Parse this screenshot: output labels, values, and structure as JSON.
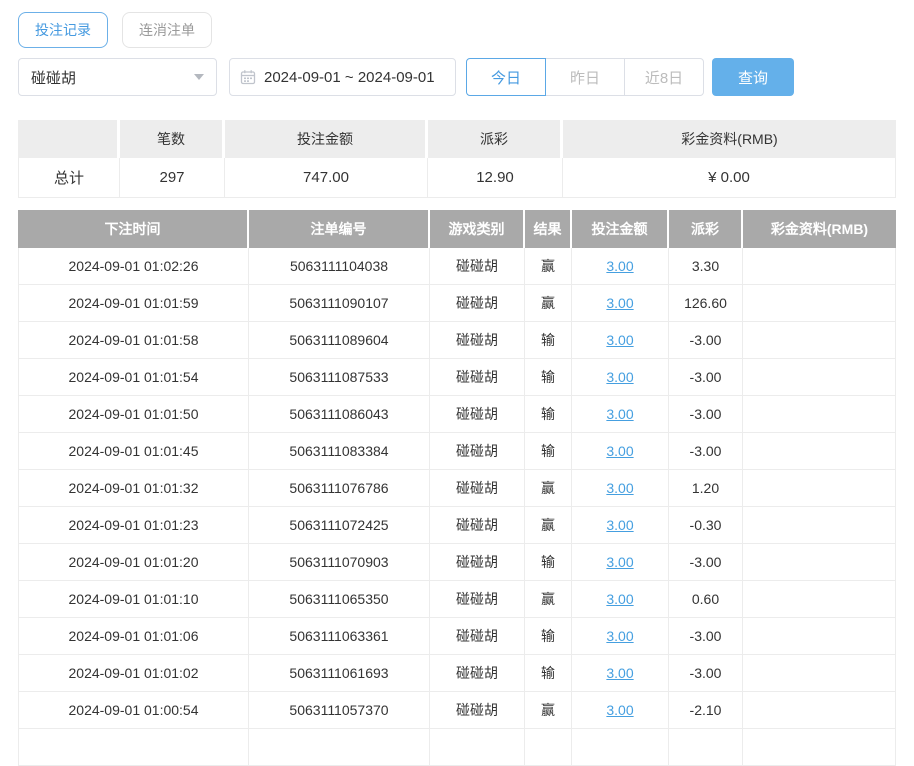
{
  "tabs": {
    "records_label": "投注记录",
    "cancelled_label": "连消注单"
  },
  "filters": {
    "game_select": {
      "value": "碰碰胡"
    },
    "date_range": {
      "value": "2024-09-01 ~ 2024-09-01"
    },
    "quick_buttons": [
      {
        "label": "今日",
        "active": true
      },
      {
        "label": "昨日",
        "active": false
      },
      {
        "label": "近8日",
        "active": false
      }
    ],
    "search_label": "查询"
  },
  "summary": {
    "headers": [
      "",
      "笔数",
      "投注金额",
      "派彩",
      "彩金资料(RMB)"
    ],
    "row": {
      "label": "总计",
      "count": "297",
      "bet_amount": "747.00",
      "payout": "12.90",
      "bonus": "¥ 0.00"
    }
  },
  "table": {
    "headers": [
      "下注时间",
      "注单编号",
      "游戏类别",
      "结果",
      "投注金额",
      "派彩",
      "彩金资料(RMB)"
    ],
    "rows": [
      {
        "time": "2024-09-01 01:02:26",
        "order_id": "5063111104038",
        "game": "碰碰胡",
        "result": "赢",
        "bet": "3.00",
        "payout": "3.30",
        "bonus": ""
      },
      {
        "time": "2024-09-01 01:01:59",
        "order_id": "5063111090107",
        "game": "碰碰胡",
        "result": "赢",
        "bet": "3.00",
        "payout": "126.60",
        "bonus": ""
      },
      {
        "time": "2024-09-01 01:01:58",
        "order_id": "5063111089604",
        "game": "碰碰胡",
        "result": "输",
        "bet": "3.00",
        "payout": "-3.00",
        "bonus": ""
      },
      {
        "time": "2024-09-01 01:01:54",
        "order_id": "5063111087533",
        "game": "碰碰胡",
        "result": "输",
        "bet": "3.00",
        "payout": "-3.00",
        "bonus": ""
      },
      {
        "time": "2024-09-01 01:01:50",
        "order_id": "5063111086043",
        "game": "碰碰胡",
        "result": "输",
        "bet": "3.00",
        "payout": "-3.00",
        "bonus": ""
      },
      {
        "time": "2024-09-01 01:01:45",
        "order_id": "5063111083384",
        "game": "碰碰胡",
        "result": "输",
        "bet": "3.00",
        "payout": "-3.00",
        "bonus": ""
      },
      {
        "time": "2024-09-01 01:01:32",
        "order_id": "5063111076786",
        "game": "碰碰胡",
        "result": "赢",
        "bet": "3.00",
        "payout": "1.20",
        "bonus": ""
      },
      {
        "time": "2024-09-01 01:01:23",
        "order_id": "5063111072425",
        "game": "碰碰胡",
        "result": "赢",
        "bet": "3.00",
        "payout": "-0.30",
        "bonus": ""
      },
      {
        "time": "2024-09-01 01:01:20",
        "order_id": "5063111070903",
        "game": "碰碰胡",
        "result": "输",
        "bet": "3.00",
        "payout": "-3.00",
        "bonus": ""
      },
      {
        "time": "2024-09-01 01:01:10",
        "order_id": "5063111065350",
        "game": "碰碰胡",
        "result": "赢",
        "bet": "3.00",
        "payout": "0.60",
        "bonus": ""
      },
      {
        "time": "2024-09-01 01:01:06",
        "order_id": "5063111063361",
        "game": "碰碰胡",
        "result": "输",
        "bet": "3.00",
        "payout": "-3.00",
        "bonus": ""
      },
      {
        "time": "2024-09-01 01:01:02",
        "order_id": "5063111061693",
        "game": "碰碰胡",
        "result": "输",
        "bet": "3.00",
        "payout": "-3.00",
        "bonus": ""
      },
      {
        "time": "2024-09-01 01:00:54",
        "order_id": "5063111057370",
        "game": "碰碰胡",
        "result": "赢",
        "bet": "3.00",
        "payout": "-2.10",
        "bonus": ""
      }
    ]
  },
  "colors": {
    "accent_blue": "#459ae0",
    "search_button_blue": "#64b0ea",
    "link_blue": "#459fe0",
    "negative_red": "#f56c6c",
    "table_header_gray": "#a9a9a9",
    "summary_header_gray": "#ededed"
  }
}
